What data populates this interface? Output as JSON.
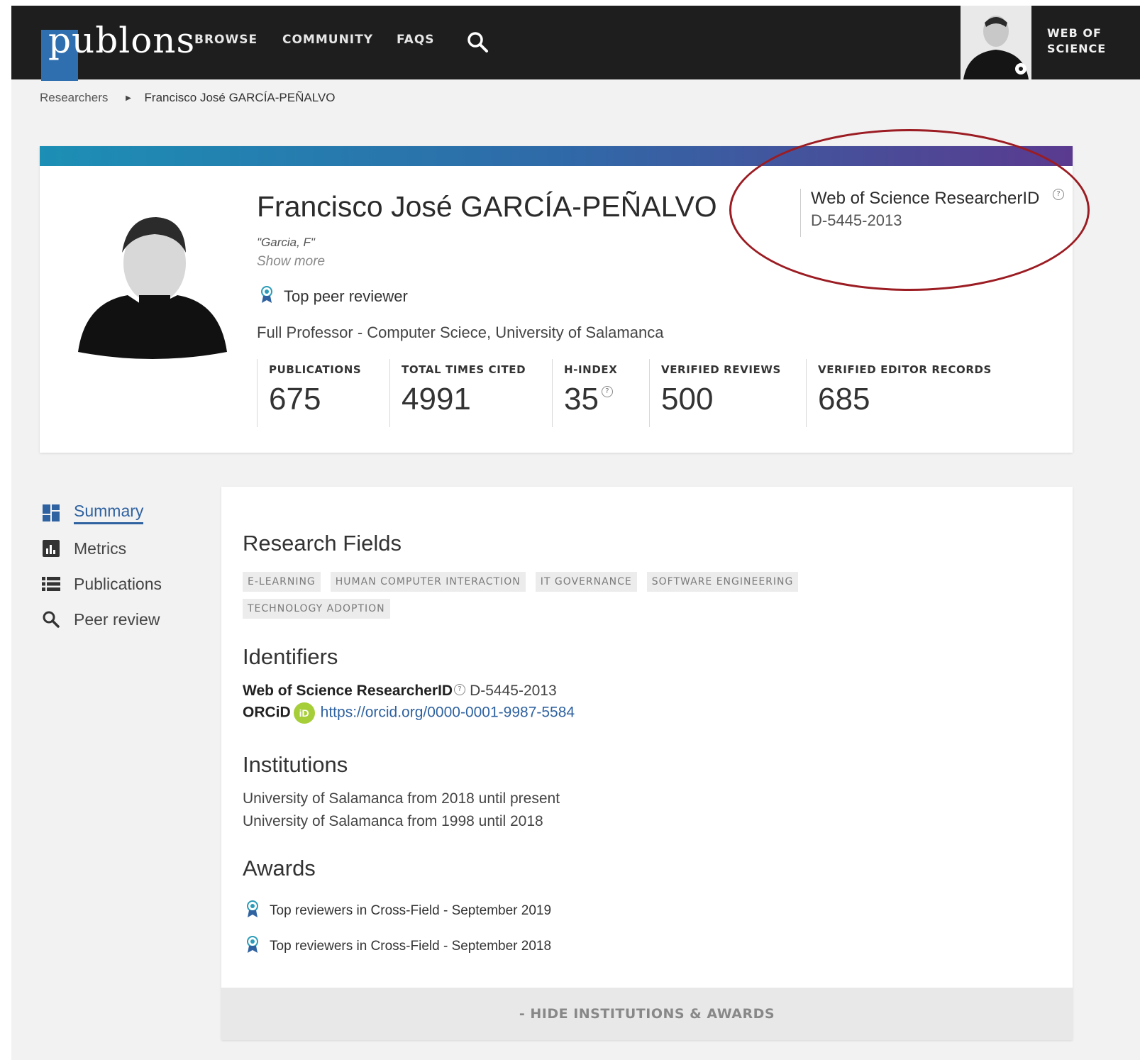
{
  "nav": {
    "logo": "publons",
    "browse": "BROWSE",
    "community": "COMMUNITY",
    "faqs": "FAQS",
    "wos_line1": "WEB OF",
    "wos_line2": "SCIENCE"
  },
  "breadcrumb": {
    "parent": "Researchers",
    "current": "Francisco José GARCÍA-PEÑALVO"
  },
  "profile": {
    "name": "Francisco José GARCÍA-PEÑALVO",
    "alias": "\"Garcia, F\"",
    "show_more": "Show more",
    "top_reviewer": "Top peer reviewer",
    "position": "Full Professor - Computer Sciece, University of Salamanca",
    "researcher_id_label": "Web of Science ResearcherID",
    "researcher_id": "D-5445-2013",
    "stats": [
      {
        "label": "PUBLICATIONS",
        "value": "675"
      },
      {
        "label": "TOTAL TIMES CITED",
        "value": "4991"
      },
      {
        "label": "H-INDEX",
        "value": "35"
      },
      {
        "label": "VERIFIED REVIEWS",
        "value": "500"
      },
      {
        "label": "VERIFIED EDITOR RECORDS",
        "value": "685"
      }
    ]
  },
  "sidebar": {
    "items": [
      {
        "label": "Summary",
        "icon": "dashboard-icon",
        "active": true
      },
      {
        "label": "Metrics",
        "icon": "bar-chart-icon",
        "active": false
      },
      {
        "label": "Publications",
        "icon": "list-icon",
        "active": false
      },
      {
        "label": "Peer review",
        "icon": "search-icon",
        "active": false
      }
    ]
  },
  "summary": {
    "research_fields_title": "Research Fields",
    "fields": [
      "E-LEARNING",
      "HUMAN COMPUTER INTERACTION",
      "IT GOVERNANCE",
      "SOFTWARE ENGINEERING",
      "TECHNOLOGY ADOPTION"
    ],
    "identifiers_title": "Identifiers",
    "rid_label": "Web of Science ResearcherID",
    "rid_value": "D-5445-2013",
    "orcid_label": "ORCiD",
    "orcid_badge": "iD",
    "orcid_url": "https://orcid.org/0000-0001-9987-5584",
    "institutions_title": "Institutions",
    "institutions": [
      "University of Salamanca from 2018 until present",
      "University of Salamanca from 1998 until 2018"
    ],
    "awards_title": "Awards",
    "awards": [
      "Top reviewers in Cross-Field - September 2019",
      "Top reviewers in Cross-Field - September 2018"
    ],
    "hide_label": "- HIDE INSTITUTIONS & AWARDS"
  },
  "colors": {
    "nav_bg": "#1e1e1e",
    "logo_blue": "#2f6fb0",
    "accent_blue": "#2f62a0",
    "gradient_start": "#1c8fb5",
    "gradient_end": "#5a3a8f",
    "highlight_ellipse": "#9b1c22",
    "orcid_green": "#a6ce39"
  }
}
